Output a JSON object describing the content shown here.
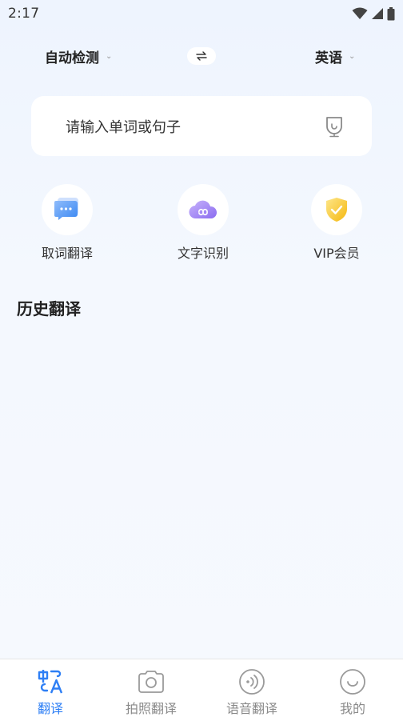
{
  "status_bar": {
    "time": "2:17"
  },
  "language": {
    "source": "自动检测",
    "target": "英语",
    "caret": "⌄"
  },
  "input": {
    "placeholder": "请输入单词或句子"
  },
  "features": [
    {
      "label": "取词翻译",
      "icon": "chat-bubble-icon"
    },
    {
      "label": "文字识别",
      "icon": "cloud-icon"
    },
    {
      "label": "VIP会员",
      "icon": "shield-icon"
    }
  ],
  "history": {
    "title": "历史翻译"
  },
  "tabs": [
    {
      "label": "翻译",
      "icon": "translate-icon",
      "active": true
    },
    {
      "label": "拍照翻译",
      "icon": "camera-icon",
      "active": false
    },
    {
      "label": "语音翻译",
      "icon": "voice-icon",
      "active": false
    },
    {
      "label": "我的",
      "icon": "smile-icon",
      "active": false
    }
  ],
  "colors": {
    "accent": "#2e7ff5",
    "background": "#f2f7fe",
    "gold": "#f7c531",
    "purple": "#9a7cf0"
  }
}
